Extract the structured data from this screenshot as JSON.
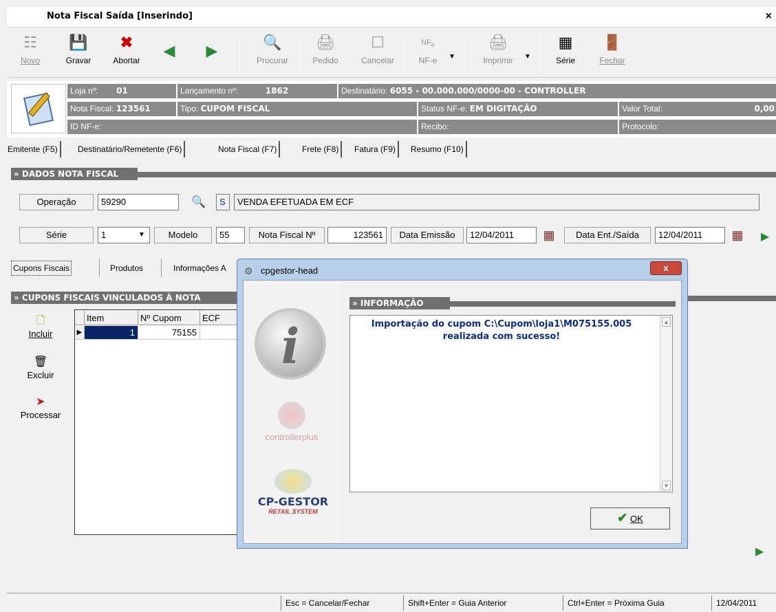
{
  "window": {
    "title": "Nota Fiscal Saída [Inserindo]",
    "close_glyph": "×"
  },
  "toolbar": {
    "novo": "Novo",
    "gravar": "Gravar",
    "abortar": "Abortar",
    "procurar": "Procurar",
    "pedido": "Pedido",
    "cancelar": "Cancelar",
    "nfe": "NF-e",
    "imprimir": "Imprimir",
    "serie": "Série",
    "fechar": "Fechar"
  },
  "header": {
    "loja_label": "Loja nº:",
    "loja_value": "01",
    "lancamento_label": "Lançamento nº:",
    "lancamento_value": "1862",
    "destinatario_label": "Destinatário:",
    "destinatario_value": "6055 - 00.000.000/0000-00 - CONTROLLER",
    "nota_label": "Nota Fiscal:",
    "nota_value": "123561",
    "tipo_label": "Tipo:",
    "tipo_value": "CUPOM FISCAL",
    "status_label": "Status NF-e:",
    "status_value": "EM DIGITAÇÃO",
    "valor_label": "Valor Total:",
    "valor_value": "0,00",
    "idnfe_label": "ID NF-e:",
    "recibo_label": "Recibo:",
    "protocolo_label": "Protocolo:"
  },
  "tabs": [
    "Emitente (F5)",
    "Destinatário/Remetente (F6)",
    "Nota Fiscal (F7)",
    "Frete (F8)",
    "Fatura (F9)",
    "Resumo (F10)"
  ],
  "dados": {
    "section_title": "» DADOS NOTA FISCAL",
    "operacao_label": "Operação",
    "operacao_value": "59290",
    "operacao_flag": "S",
    "operacao_desc": "VENDA EFETUADA EM ECF",
    "serie_label": "Série",
    "serie_value": "1",
    "modelo_label": "Modelo",
    "modelo_value": "55",
    "nf_label": "Nota Fiscal Nº",
    "nf_value": "123561",
    "emissao_label": "Data Emissão",
    "emissao_value": "12/04/2011",
    "entsaida_label": "Data Ent./Saída",
    "entsaida_value": "12/04/2011"
  },
  "subtabs": [
    "Cupons Fiscais",
    "Produtos",
    "Informações A"
  ],
  "cupons": {
    "section_title": "» CUPONS FISCAIS VINCULADOS  À NOTA",
    "columns": [
      "Item",
      "Nº Cupom",
      "ECF"
    ],
    "rows": [
      {
        "item": "1",
        "cupom": "75155",
        "ecf": ""
      }
    ],
    "incluir": "Incluir",
    "excluir": "Excluir",
    "processar": "Processar"
  },
  "dialog": {
    "title": "cpgestor-head",
    "close": "x",
    "section_title": "» INFORMAÇÃO",
    "message": "Importação do cupom C:\\Cupom\\loja1\\M075155.005 realizada com sucesso!",
    "ok": "OK",
    "brand1": "controllerplus",
    "brand2": "CP-GESTOR",
    "brand2_sub": "RETAIL SYSTEM"
  },
  "statusbar": {
    "esc": "Esc = Cancelar/Fechar",
    "shift": "Shift+Enter = Guia Anterior",
    "ctrl": "Ctrl+Enter = Próxima Guia",
    "date": "12/04/2011"
  },
  "colors": {
    "header_bg": "#8a8a8a",
    "section_bg": "#707070",
    "grid_select": "#0a246a",
    "dialog_msg": "#0a2d8a"
  }
}
